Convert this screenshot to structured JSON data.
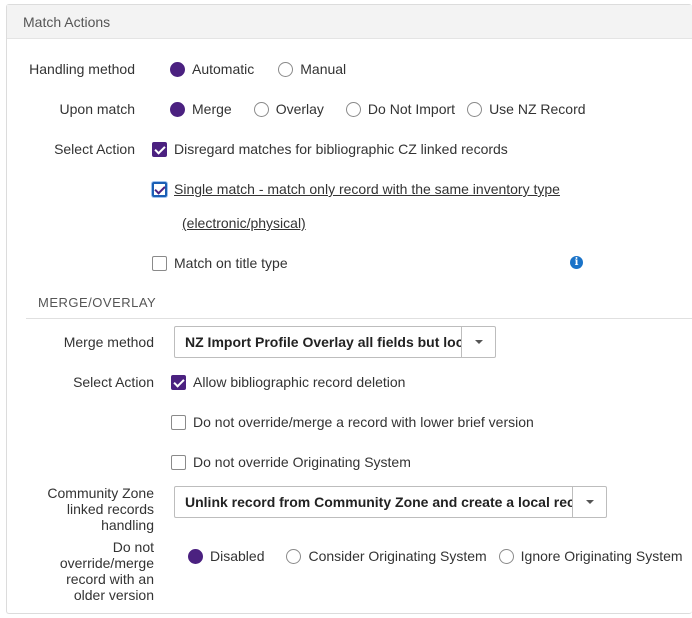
{
  "panel": {
    "title": "Match Actions"
  },
  "handling": {
    "label": "Handling method",
    "options": [
      {
        "label": "Automatic",
        "selected": true
      },
      {
        "label": "Manual",
        "selected": false
      }
    ]
  },
  "upon_match": {
    "label": "Upon match",
    "options": [
      {
        "label": "Merge",
        "selected": true
      },
      {
        "label": "Overlay",
        "selected": false
      },
      {
        "label": "Do Not Import",
        "selected": false
      },
      {
        "label": "Use NZ Record",
        "selected": false
      }
    ]
  },
  "select_action_1": {
    "label": "Select Action",
    "disregard": {
      "label": "Disregard matches for bibliographic CZ linked records",
      "checked": true
    },
    "single_match": {
      "label_line1": "Single match - match only record with the same inventory type",
      "label_line2": "(electronic/physical)",
      "checked": true
    },
    "title_type": {
      "label": "Match on title type",
      "checked": false
    },
    "info_icon": "info-icon"
  },
  "merge_overlay": {
    "section_title": "MERGE/OVERLAY",
    "merge_method": {
      "label": "Merge method",
      "value": "NZ Import Profile Overlay all fields but local"
    },
    "select_action": {
      "label": "Select Action",
      "allow_deletion": {
        "label": "Allow bibliographic record deletion",
        "checked": true
      },
      "lower_brief": {
        "label": "Do not override/merge a record with lower brief version",
        "checked": false
      },
      "originating": {
        "label": "Do not override Originating System",
        "checked": false
      }
    },
    "cz_handling": {
      "label_lines": [
        "Community Zone",
        "linked records",
        "handling"
      ],
      "value": "Unlink record from Community Zone and create a local record"
    },
    "older_version": {
      "label_lines": [
        "Do not",
        "override/merge",
        "record with an",
        "older version"
      ],
      "options": [
        {
          "label": "Disabled",
          "selected": true
        },
        {
          "label": "Consider Originating System",
          "selected": false
        },
        {
          "label": "Ignore Originating System",
          "selected": false
        }
      ]
    }
  },
  "colors": {
    "accent": "#4b2180",
    "info": "#1a73c8"
  }
}
